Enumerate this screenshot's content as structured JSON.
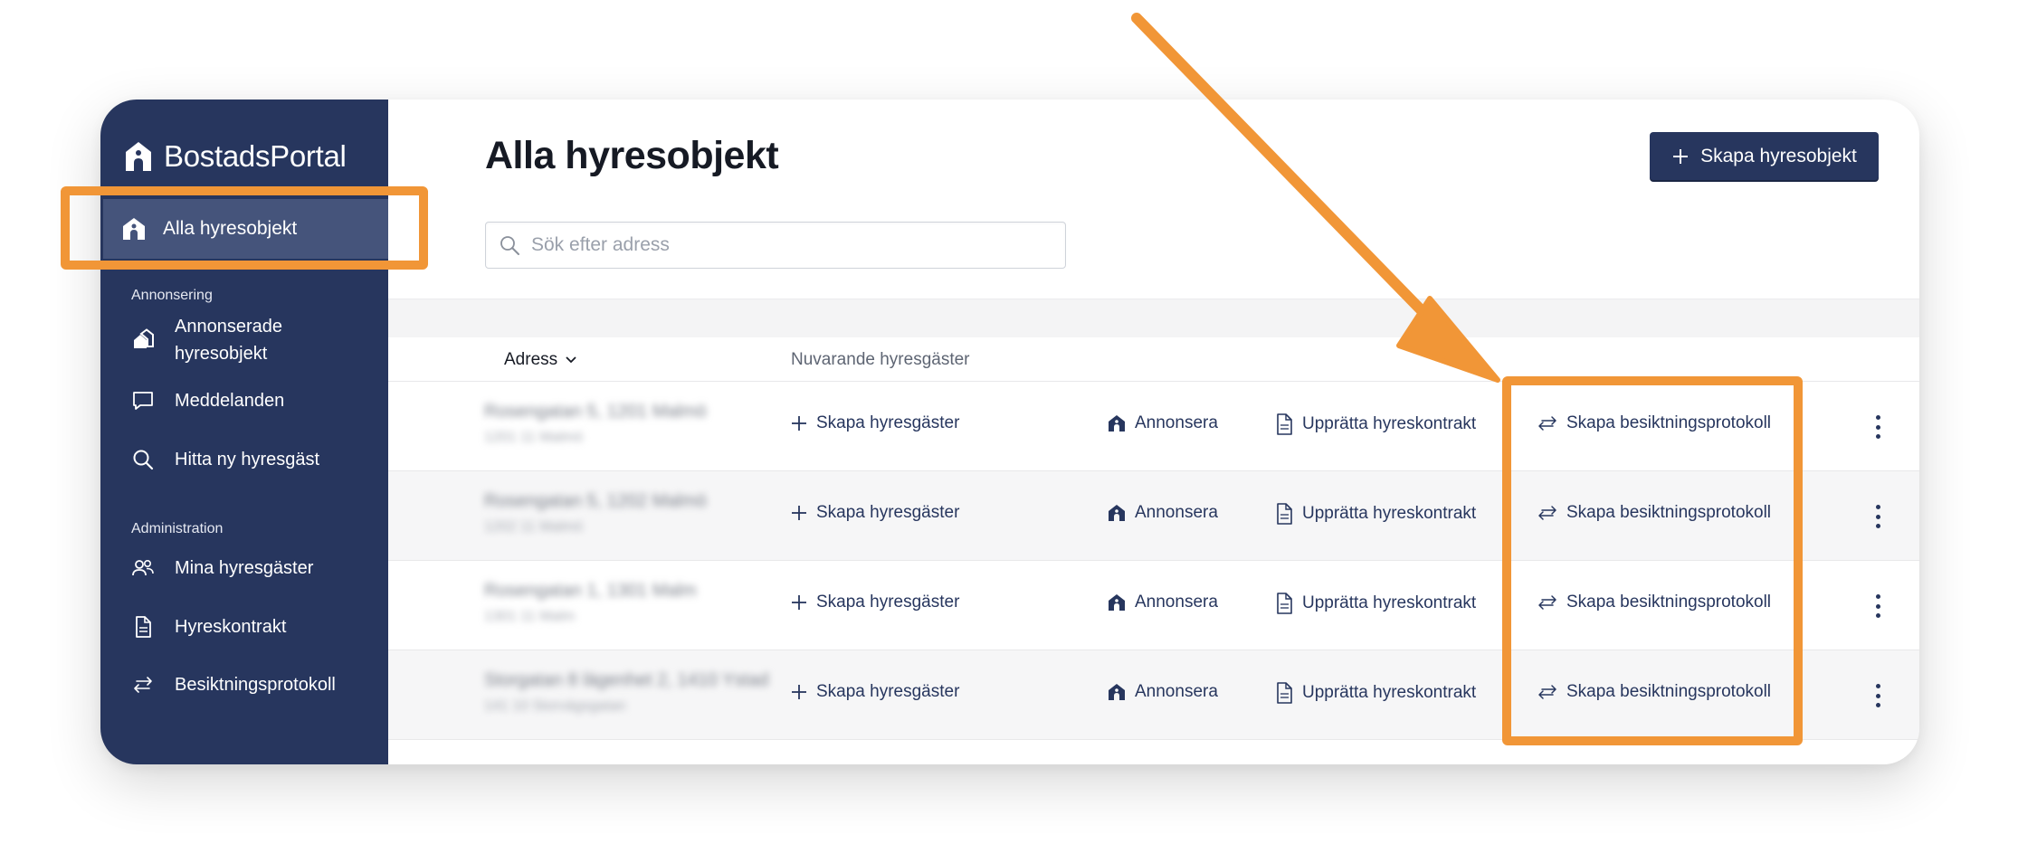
{
  "brand": {
    "name": "BostadsPortal"
  },
  "sidebar": {
    "active_item": {
      "label": "Alla hyresobjekt",
      "icon": "house-icon"
    },
    "sections": [
      {
        "label": "Annonsering",
        "items": [
          {
            "label": "Annonserade hyresobjekt",
            "icon": "houses-icon"
          },
          {
            "label": "Meddelanden",
            "icon": "chat-icon"
          },
          {
            "label": "Hitta ny hyresgäst",
            "icon": "search-icon"
          }
        ]
      },
      {
        "label": "Administration",
        "items": [
          {
            "label": "Mina hyresgäster",
            "icon": "users-icon"
          },
          {
            "label": "Hyreskontrakt",
            "icon": "document-icon"
          },
          {
            "label": "Besiktningsprotokoll",
            "icon": "swap-arrows-icon"
          }
        ]
      }
    ]
  },
  "main": {
    "title": "Alla hyresobjekt",
    "create_button": "Skapa hyresobjekt",
    "search_placeholder": "Sök efter adress",
    "columns": {
      "address": "Adress",
      "tenants": "Nuvarande hyresgäster"
    },
    "rows": [
      {
        "address_line1": "Rosengatan 5, 1201 Malmö",
        "address_line2": "1201 11 Malmö",
        "tenants_action": "Skapa hyresgäster",
        "advertise": "Annonsera",
        "contract": "Upprätta hyreskontrakt",
        "inspection": "Skapa besiktningsprotokoll"
      },
      {
        "address_line1": "Rosengatan 5, 1202 Malmö",
        "address_line2": "1202 11 Malmö",
        "tenants_action": "Skapa hyresgäster",
        "advertise": "Annonsera",
        "contract": "Upprätta hyreskontrakt",
        "inspection": "Skapa besiktningsprotokoll"
      },
      {
        "address_line1": "Rosengatan 1, 1301 Malm",
        "address_line2": "1301 11 Malm",
        "tenants_action": "Skapa hyresgäster",
        "advertise": "Annonsera",
        "contract": "Upprätta hyreskontrakt",
        "inspection": "Skapa besiktningsprotokoll"
      },
      {
        "address_line1": "Storgatan 8 lägenhet 2, 1410 Ystad",
        "address_line2": "141 10 Storvägsgatan",
        "tenants_action": "Skapa hyresgäster",
        "advertise": "Annonsera",
        "contract": "Upprätta hyreskontrakt",
        "inspection": "Skapa besiktningsprotokoll"
      }
    ]
  },
  "colors": {
    "sidebar": "#27365e",
    "sidebar_active": "#45547b",
    "highlight": "#f19637",
    "accent": "#27365e"
  }
}
